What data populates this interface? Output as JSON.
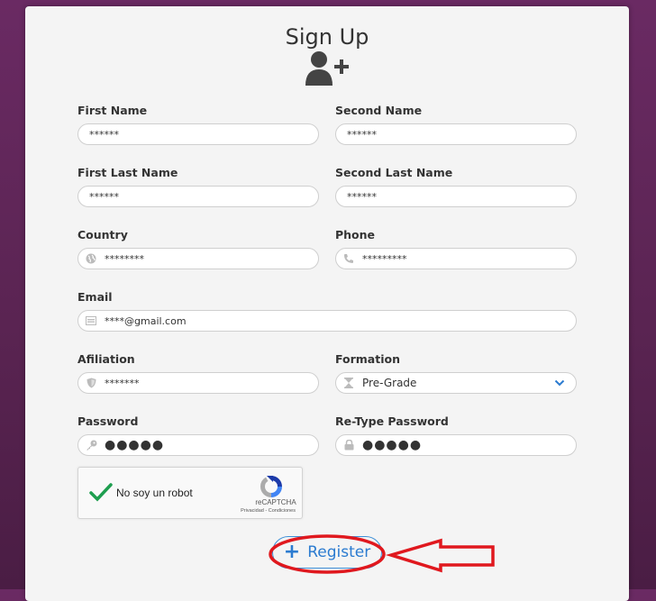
{
  "form": {
    "title": "Sign Up",
    "fields": {
      "first_name": {
        "label": "First Name",
        "value": "******"
      },
      "second_name": {
        "label": "Second Name",
        "value": "******"
      },
      "first_last_name": {
        "label": "First Last Name",
        "value": "******"
      },
      "second_last_name": {
        "label": "Second Last Name",
        "value": "******"
      },
      "country": {
        "label": "Country",
        "value": "********",
        "icon": "globe-icon"
      },
      "phone": {
        "label": "Phone",
        "value": "*********",
        "icon": "phone-icon"
      },
      "email": {
        "label": "Email",
        "value": "****@gmail.com",
        "icon": "envelope-icon"
      },
      "afiliation": {
        "label": "Afiliation",
        "value": "*******",
        "icon": "shield-icon"
      },
      "formation": {
        "label": "Formation",
        "value": "Pre-Grade",
        "icon": "hourglass-icon"
      },
      "password": {
        "label": "Password",
        "value": "●●●●●",
        "icon": "key-icon"
      },
      "retype_password": {
        "label": "Re-Type Password",
        "value": "●●●●●",
        "icon": "lock-icon"
      }
    },
    "captcha": {
      "label": "No soy un robot",
      "brand": "reCAPTCHA",
      "terms": "Privacidad - Condiciones",
      "checked": true
    },
    "register_label": "Register"
  },
  "colors": {
    "background": "#5a2452",
    "card": "#f4f4f4",
    "accent": "#2b7bd0",
    "annotation": "#e0181e",
    "check": "#1e9e4f"
  }
}
